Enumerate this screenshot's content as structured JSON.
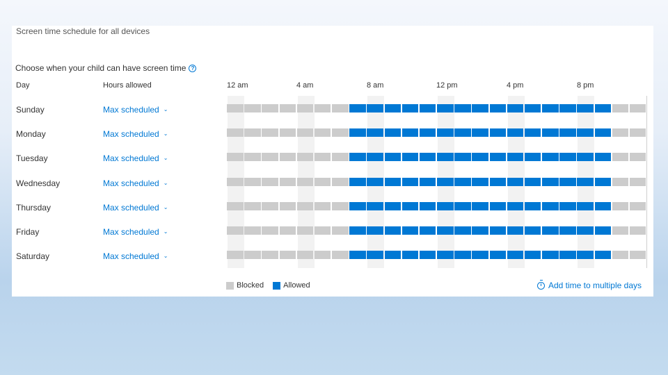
{
  "panel": {
    "title": "Screen time schedule for all devices",
    "question": "Choose when your child can have screen time",
    "help_icon": "question-circle-icon"
  },
  "columns": {
    "day": "Day",
    "hours_allowed": "Hours allowed"
  },
  "time_labels": [
    "12 am",
    "4 am",
    "8 am",
    "12 pm",
    "4 pm",
    "8 pm"
  ],
  "days": [
    {
      "name": "Sunday",
      "hours": "Max scheduled"
    },
    {
      "name": "Monday",
      "hours": "Max scheduled"
    },
    {
      "name": "Tuesday",
      "hours": "Max scheduled"
    },
    {
      "name": "Wednesday",
      "hours": "Max scheduled"
    },
    {
      "name": "Thursday",
      "hours": "Max scheduled"
    },
    {
      "name": "Friday",
      "hours": "Max scheduled"
    },
    {
      "name": "Saturday",
      "hours": "Max scheduled"
    }
  ],
  "schedule": {
    "slots_per_day": 24,
    "allowed_from_hour": 7,
    "allowed_until_hour": 22
  },
  "legend": {
    "blocked": "Blocked",
    "allowed": "Allowed"
  },
  "add_link": {
    "label": "Add time to multiple days",
    "icon": "timer-icon"
  },
  "colors": {
    "blocked": "#cccccc",
    "allowed": "#0078d4",
    "link": "#0078d4"
  }
}
